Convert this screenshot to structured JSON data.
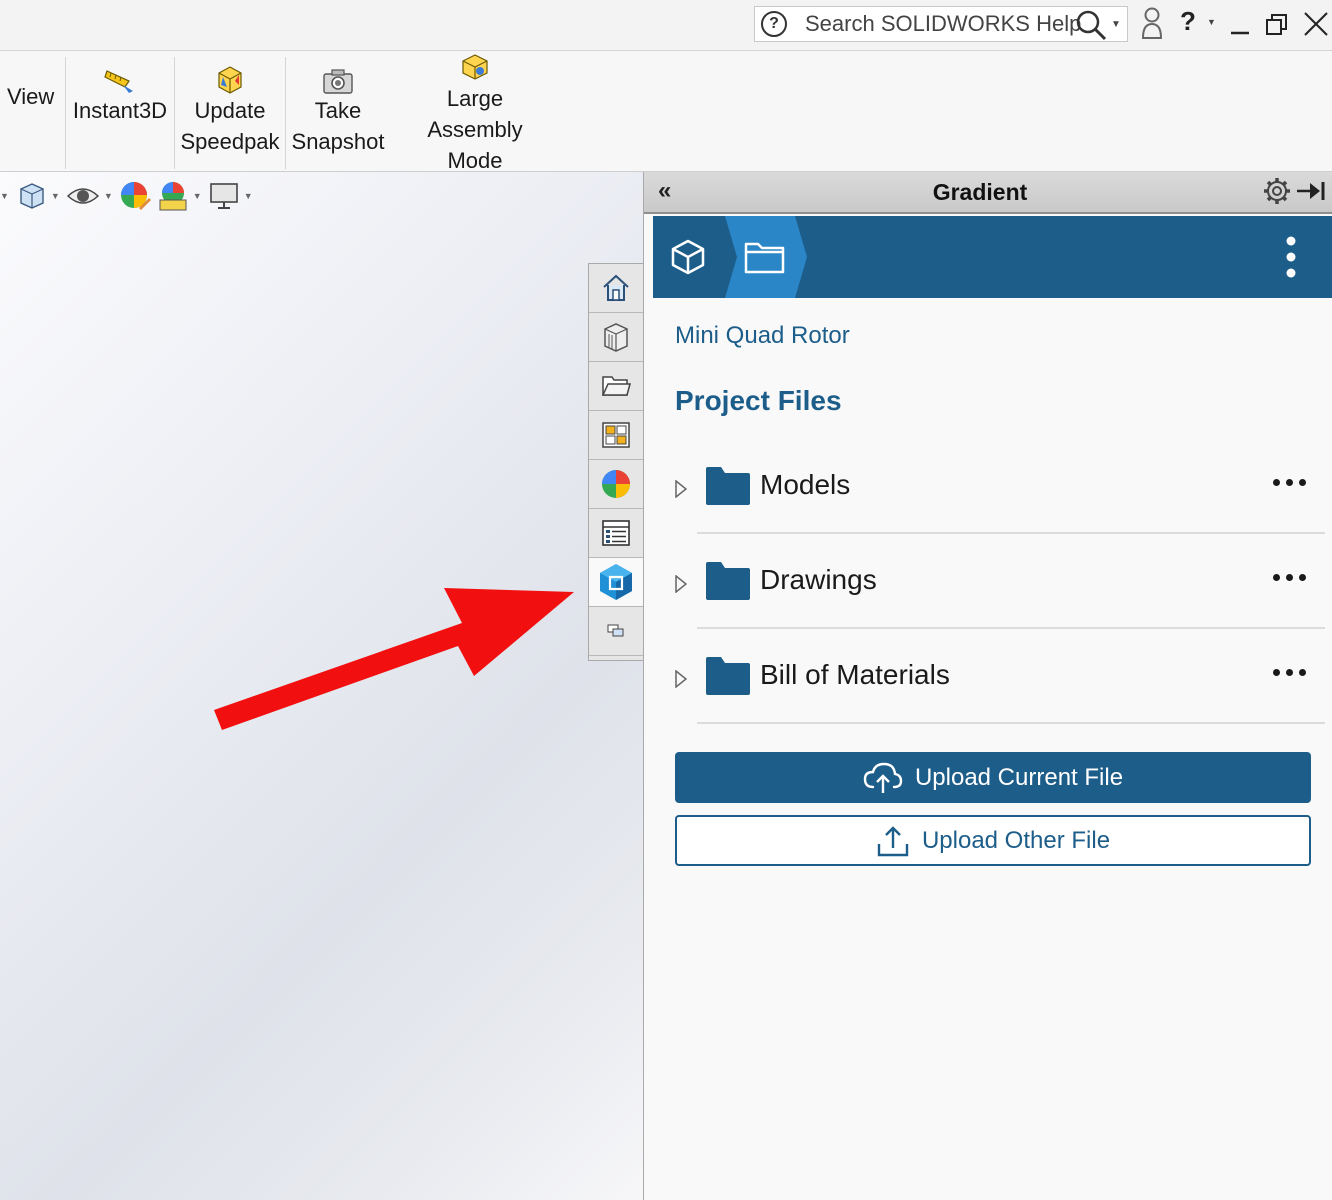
{
  "titlebar": {
    "help_search_placeholder": "Search SOLIDWORKS Help",
    "help_label": "?"
  },
  "ribbon": {
    "items": [
      {
        "label": "l View"
      },
      {
        "label": "Instant3D"
      },
      {
        "label": "Update Speedpak"
      },
      {
        "label": "Take Snapshot"
      },
      {
        "label": "Large Assembly Mode"
      }
    ]
  },
  "task_pane": {
    "collapse_label": "«",
    "title": "Gradient",
    "project_name": "Mini Quad Rotor",
    "section_title": "Project Files",
    "folders": [
      {
        "name": "Models"
      },
      {
        "name": "Drawings"
      },
      {
        "name": "Bill of Materials"
      }
    ],
    "upload_current_label": "Upload Current File",
    "upload_other_label": "Upload Other File"
  },
  "colors": {
    "accent": "#1d5d8a",
    "arrow": "#f10f0f"
  }
}
